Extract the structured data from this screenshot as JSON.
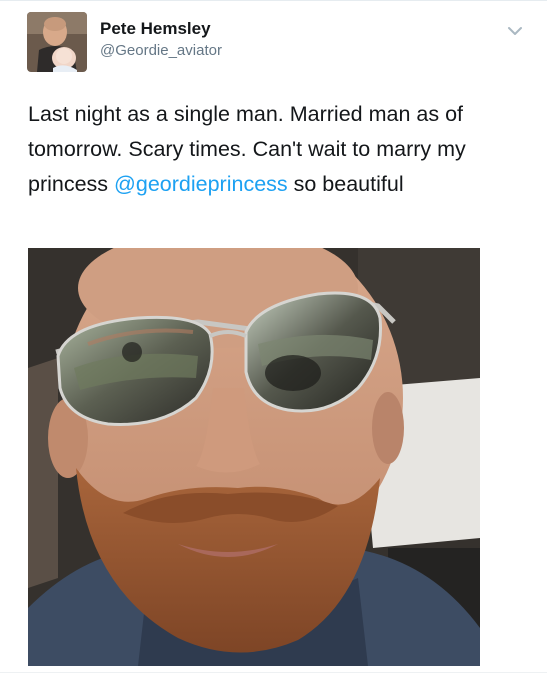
{
  "tweet": {
    "author_name": "Pete Hemsley",
    "author_handle": "@Geordie_aviator",
    "text_part1": "Last night as a single man. Married man as of tomorrow. Scary times. Can't wait to marry my princess ",
    "mention": "@geordieprincess",
    "text_part2": " so beautiful",
    "avatar_icon": "avatar-photo",
    "menu_icon": "chevron-down-icon",
    "photo_subject": "selfie-photo"
  },
  "colors": {
    "name": "#14171a",
    "handle": "#657786",
    "mention": "#1da1f2",
    "chevron": "#aab8c2"
  }
}
